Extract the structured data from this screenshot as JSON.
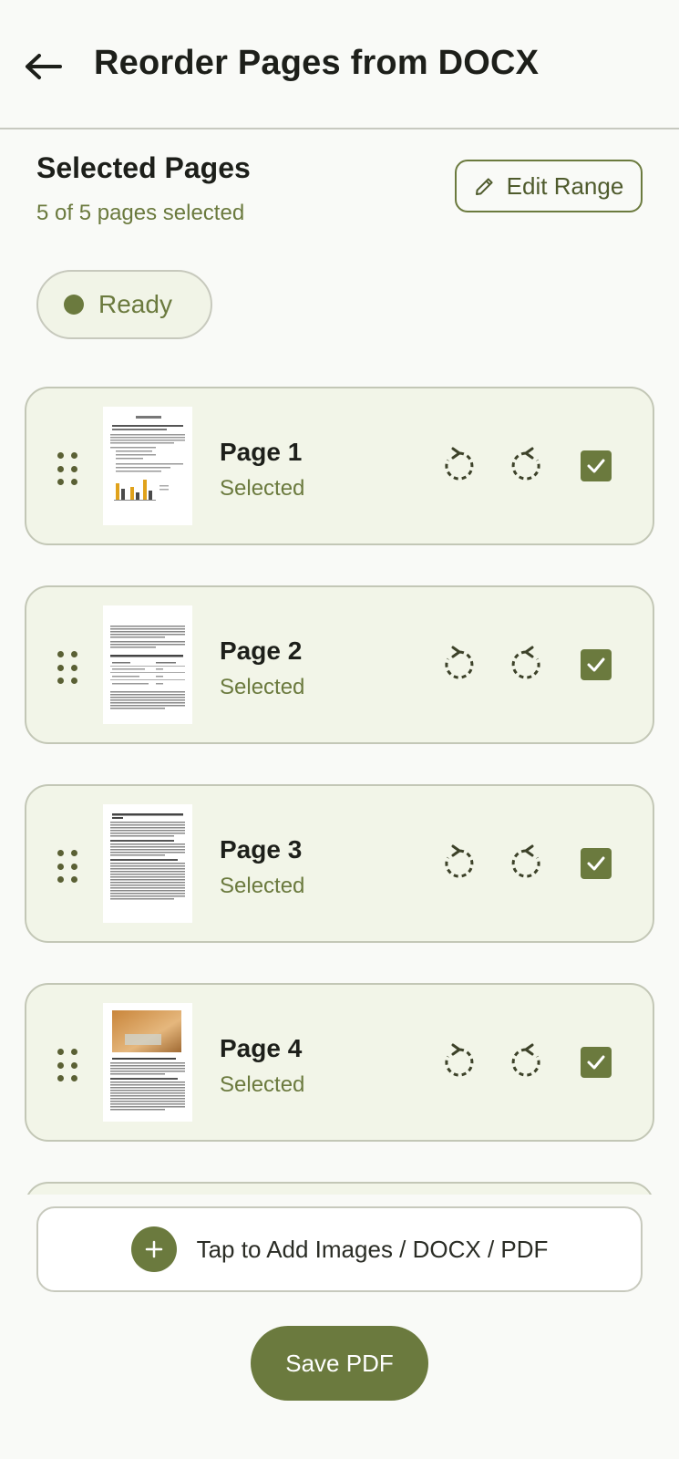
{
  "appbar": {
    "title": "Reorder Pages from DOCX",
    "back_icon": "arrow-left-icon"
  },
  "selection": {
    "heading": "Selected Pages",
    "summary": "5 of 5 pages selected",
    "edit_range_label": "Edit Range",
    "edit_icon": "pencil-icon"
  },
  "status": {
    "label": "Ready",
    "color": "#6b7a3e"
  },
  "pages": [
    {
      "title": "Page 1",
      "state": "Selected",
      "checked": true,
      "thumbnail": "document-with-bar-chart"
    },
    {
      "title": "Page 2",
      "state": "Selected",
      "checked": true,
      "thumbnail": "document-with-table"
    },
    {
      "title": "Page 3",
      "state": "Selected",
      "checked": true,
      "thumbnail": "text-document"
    },
    {
      "title": "Page 4",
      "state": "Selected",
      "checked": true,
      "thumbnail": "document-with-photo"
    }
  ],
  "add_files": {
    "label": "Tap to Add Images / DOCX / PDF",
    "icon": "plus-icon"
  },
  "save_button": {
    "label": "Save PDF"
  },
  "colors": {
    "accent": "#6b7a3e",
    "card_background": "#f2f5e8",
    "page_background": "#f9faf7"
  }
}
